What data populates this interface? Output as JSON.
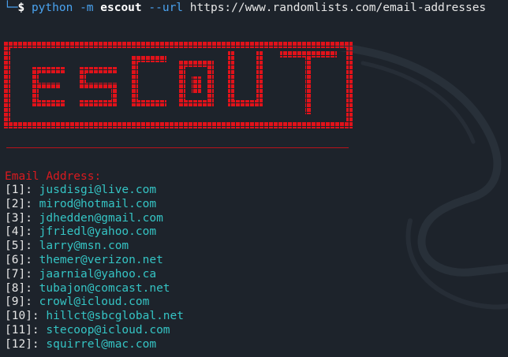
{
  "terminal": {
    "prompt_tree": "└─",
    "prompt_symbol": "$",
    "command": "python",
    "flag_m": "-m",
    "module": "escout",
    "flag_url": "--url",
    "url": "https://www.randomlists.com/email-addresses"
  },
  "banner": {
    "text": "ESCOUT",
    "color": "#e0121a"
  },
  "results": {
    "heading": "Email Address:",
    "heading_color": "#d91a1f",
    "value_color": "#35c4c4",
    "items": [
      {
        "index": "[1]",
        "email": "jusdisgi@live.com"
      },
      {
        "index": "[2]",
        "email": "mirod@hotmail.com"
      },
      {
        "index": "[3]",
        "email": "jdhedden@gmail.com"
      },
      {
        "index": "[4]",
        "email": "jfriedl@yahoo.com"
      },
      {
        "index": "[5]",
        "email": "larry@msn.com"
      },
      {
        "index": "[6]",
        "email": "themer@verizon.net"
      },
      {
        "index": "[7]",
        "email": "jaarnial@yahoo.ca"
      },
      {
        "index": "[8]",
        "email": "tubajon@comcast.net"
      },
      {
        "index": "[9]",
        "email": "crowl@icloud.com"
      },
      {
        "index": "[10]",
        "email": "hillct@sbcglobal.net"
      },
      {
        "index": "[11]",
        "email": "stecoop@icloud.com"
      },
      {
        "index": "[12]",
        "email": "squirrel@mac.com"
      }
    ]
  }
}
